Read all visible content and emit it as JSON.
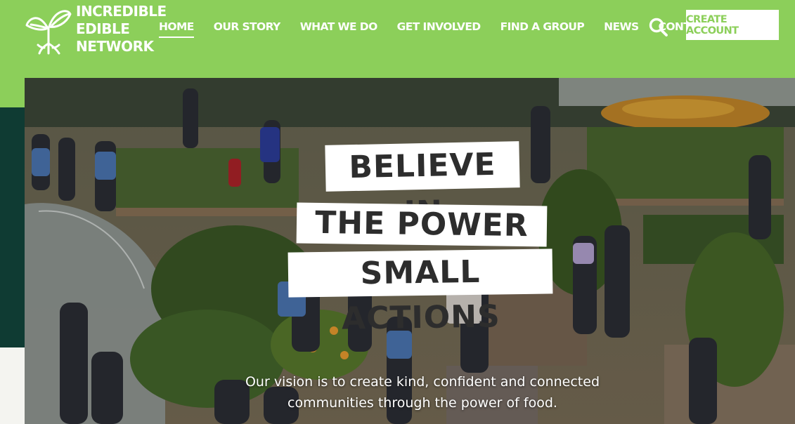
{
  "brand": {
    "logo_lines": [
      "INCREDIBLE",
      "EDIBLE",
      "NETWORK"
    ],
    "logo_icon": "seedling-icon",
    "green": "#8ccf5a",
    "dark": "#0f3b33"
  },
  "nav": {
    "items": [
      {
        "label": "HOME",
        "active": true
      },
      {
        "label": "OUR STORY",
        "active": false
      },
      {
        "label": "WHAT WE DO",
        "active": false
      },
      {
        "label": "GET INVOLVED",
        "active": false
      },
      {
        "label": "FIND A GROUP",
        "active": false
      },
      {
        "label": "NEWS",
        "active": false
      },
      {
        "label": "CONTACT",
        "active": false
      }
    ],
    "search_icon": "search-icon",
    "cta_label": "CREATE ACCOUNT"
  },
  "hero": {
    "headline_lines": [
      "BELIEVE IN",
      "THE POWER OF",
      "SMALL ACTIONS"
    ],
    "vision_lines": [
      "Our vision is to create kind, confident and connected",
      "communities through the power of food."
    ]
  }
}
